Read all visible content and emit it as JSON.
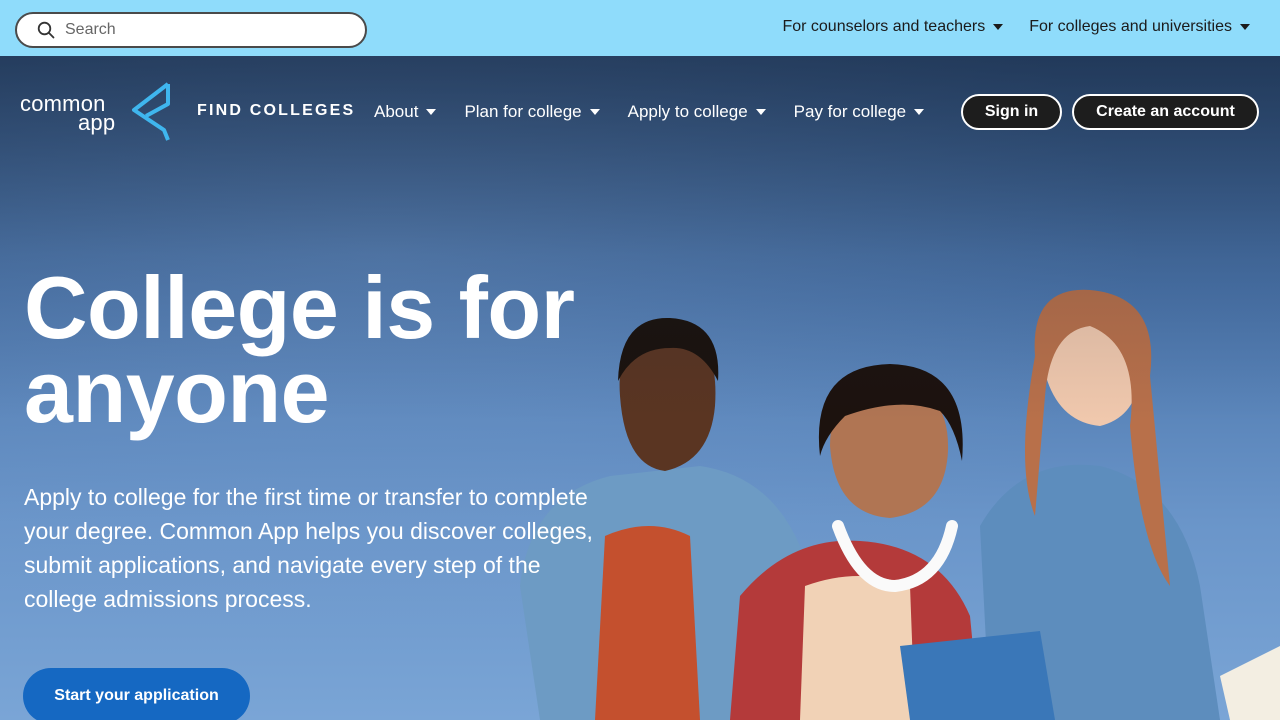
{
  "utility_bar": {
    "search_placeholder": "Search",
    "links": [
      {
        "label": "For counselors and teachers"
      },
      {
        "label": "For colleges and universities"
      }
    ]
  },
  "main_nav": {
    "logo_line1": "common",
    "logo_line2": "app",
    "find_colleges": "FIND COLLEGES",
    "items": [
      {
        "label": "About"
      },
      {
        "label": "Plan for college"
      },
      {
        "label": "Apply to college"
      },
      {
        "label": "Pay for college"
      }
    ],
    "sign_in": "Sign in",
    "create_account": "Create an account"
  },
  "hero": {
    "headline_line1": "College is for",
    "headline_line2": "anyone",
    "subtext": "Apply to college for the first time or transfer to complete your degree. Common App helps you discover colleges, submit applications, and navigate every step of the college admissions process.",
    "cta": "Start your application"
  },
  "colors": {
    "utility_bg": "#8fdcfb",
    "cta_bg": "#1568c2",
    "button_dark": "#1d1d1d",
    "logo_accent": "#3fb6ee"
  }
}
